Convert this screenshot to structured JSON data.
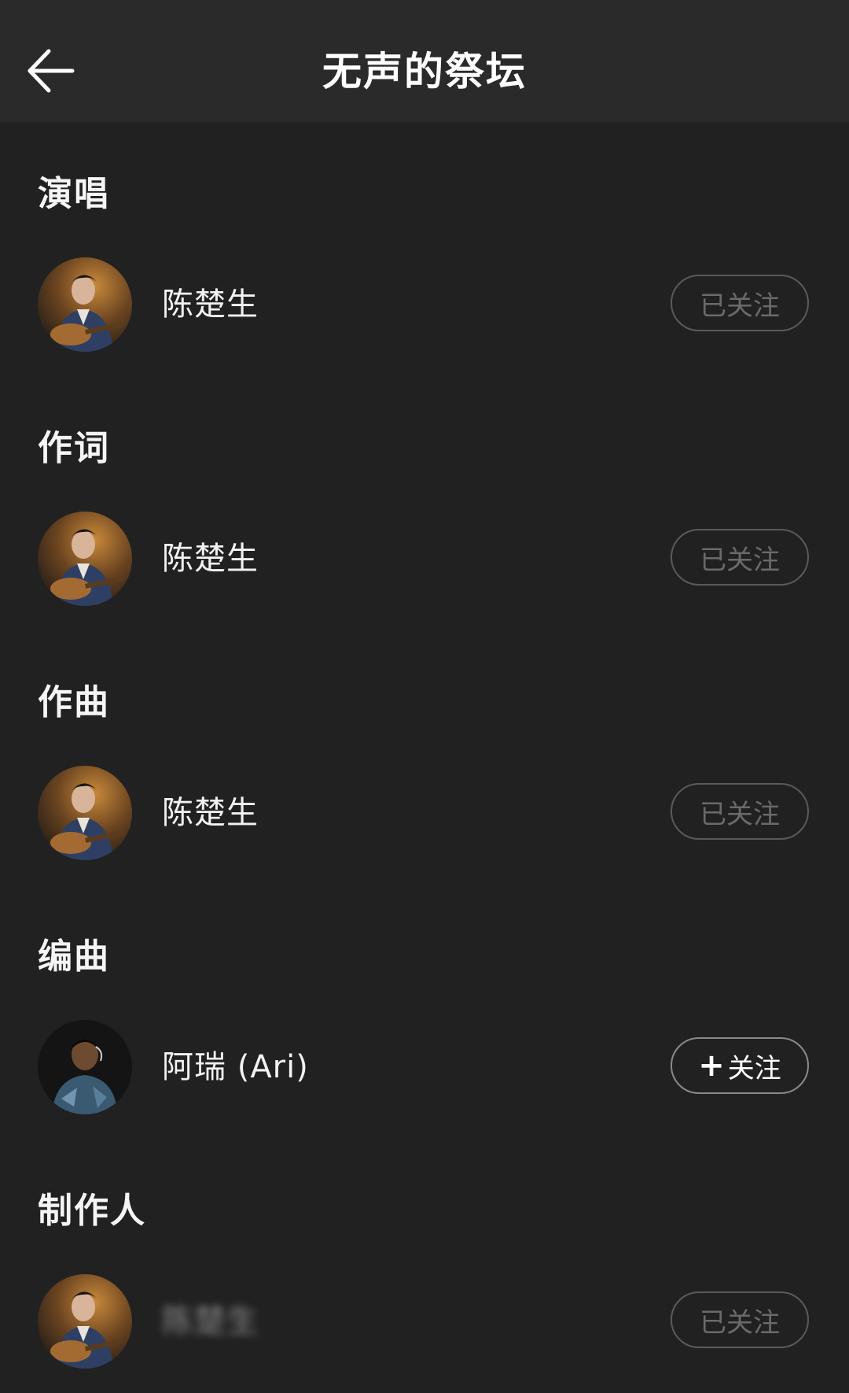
{
  "header": {
    "title": "无声的祭坛",
    "back_icon": "arrow-left-icon"
  },
  "sections": [
    {
      "role": "演唱",
      "person": {
        "name": "陈楚生",
        "follow_label": "已关注",
        "following": true
      }
    },
    {
      "role": "作词",
      "person": {
        "name": "陈楚生",
        "follow_label": "已关注",
        "following": true
      }
    },
    {
      "role": "作曲",
      "person": {
        "name": "陈楚生",
        "follow_label": "已关注",
        "following": true
      }
    },
    {
      "role": "编曲",
      "person": {
        "name": "阿瑞 (Ari)",
        "follow_label": "关注",
        "follow_icon": "plus-icon",
        "following": false
      }
    },
    {
      "role": "制作人",
      "person": {
        "name": "陈楚生",
        "follow_label": "已关注",
        "following": true
      }
    }
  ],
  "colors": {
    "background": "#212121",
    "header": "#2a2a2a",
    "followed_text": "#6a6a6a",
    "follow_text": "#ffffff"
  }
}
